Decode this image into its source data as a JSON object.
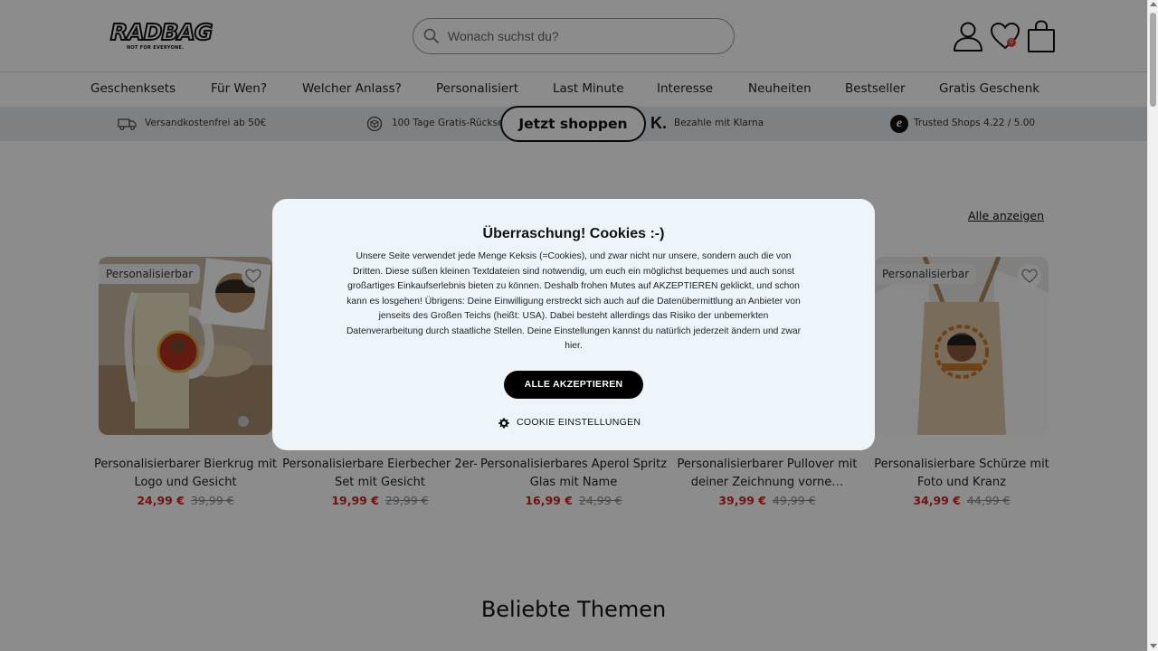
{
  "header": {
    "logo_text": "RADBAG",
    "logo_tagline": "NOT FOR EVERYONE.",
    "search_placeholder": "Wonach suchst du?",
    "wishlist_count": "0"
  },
  "nav": {
    "items": [
      "Geschenksets",
      "Für Wen?",
      "Welcher Anlass?",
      "Personalisiert",
      "Last Minute",
      "Interesse",
      "Neuheiten",
      "Bestseller",
      "Gratis Geschenk"
    ]
  },
  "usp": {
    "shipping": "Versandkostenfrei ab 50€",
    "returns": "100 Tage Gratis-Rücksendung",
    "klarna": "Bezahle mit Klarna",
    "trusted": "Trusted Shops 4.22 / 5.00"
  },
  "cta": {
    "shop_now": "Jetzt shoppen"
  },
  "products": {
    "show_all": "Alle anzeigen",
    "badge": "Personalisierbar",
    "items": [
      {
        "title": "Personalisierbarer Bierkrug mit Logo und Gesicht",
        "price": "24,99 €",
        "old_price": "39,99 €"
      },
      {
        "title": "Personalisierbare Eierbecher 2er-Set mit Gesicht",
        "price": "19,99 €",
        "old_price": "29,99 €"
      },
      {
        "title": "Personalisierbares Aperol Spritz Glas mit Name",
        "price": "16,99 €",
        "old_price": "24,99 €"
      },
      {
        "title": "Personalisierbarer Pullover mit deiner Zeichnung vorne…",
        "price": "39,99 €",
        "old_price": "49,99 €"
      },
      {
        "title": "Personalisierbare Schürze mit Foto und Kranz",
        "price": "34,99 €",
        "old_price": "44,99 €"
      }
    ]
  },
  "themes": {
    "title": "Beliebte Themen"
  },
  "cookie_modal": {
    "title": "Überraschung! Cookies :-)",
    "text": "Unsere Seite verwendet jede Menge Keksis (=Cookies), und zwar nicht nur unsere, sondern auch die von Dritten. Diese süßen kleinen Textdateien sind notwendig, um euch ein möglichst bequemes und auch sonst großartiges Einkaufserlebnis bieten zu können. Deshalb frohen Mutes auf AKZEPTIEREN geklickt, und schon kann es losgehen! Übrigens: Deine Einwilligung erstreckt sich auch auf die Datenübermittlung an Anbieter von jenseits des Großen Teichs (heißt: USA). Dabei besteht allerdings das Risiko der unbemerkten Datenverarbeitung durch staatliche Stellen. Deine Einstellungen kannst du natürlich jederzeit ändern und zwar hier.",
    "accept": "ALLE AKZEPTIEREN",
    "settings": "COOKIE EINSTELLUNGEN"
  },
  "colors": {
    "sale_red": "#d32020",
    "usp_bg": "#e3ecef",
    "modal_bg": "#edf5fb",
    "badge_red": "#e53b2c"
  }
}
